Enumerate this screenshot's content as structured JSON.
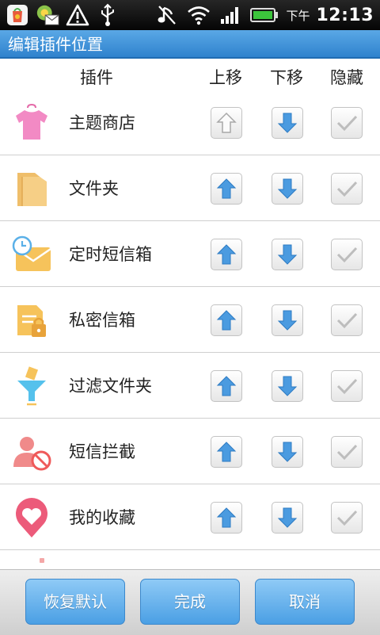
{
  "status_bar": {
    "ampm": "下午",
    "time": "12:13",
    "left_icons": [
      "app-store-icon",
      "mail-notification-icon",
      "warning-icon",
      "usb-icon"
    ],
    "right_icons": [
      "music-off-icon",
      "wifi-icon",
      "signal-icon",
      "battery-icon"
    ]
  },
  "title": "编辑插件位置",
  "columns": {
    "plugin": "插件",
    "move_up": "上移",
    "move_down": "下移",
    "hide": "隐藏"
  },
  "rows": [
    {
      "label": "主题商店",
      "icon": "shirt-icon",
      "up_enabled": false
    },
    {
      "label": "文件夹",
      "icon": "folder-icon",
      "up_enabled": true
    },
    {
      "label": "定时短信箱",
      "icon": "timed-mail-icon",
      "up_enabled": true
    },
    {
      "label": "私密信箱",
      "icon": "private-box-icon",
      "up_enabled": true
    },
    {
      "label": "过滤文件夹",
      "icon": "filter-icon",
      "up_enabled": true
    },
    {
      "label": "短信拦截",
      "icon": "sms-block-icon",
      "up_enabled": true
    },
    {
      "label": "我的收藏",
      "icon": "favorite-heart-icon",
      "up_enabled": true
    }
  ],
  "buttons": {
    "restore": "恢复默认",
    "done": "完成",
    "cancel": "取消"
  },
  "colors": {
    "accent": "#3d92da",
    "arrow": "#4b9be0"
  }
}
